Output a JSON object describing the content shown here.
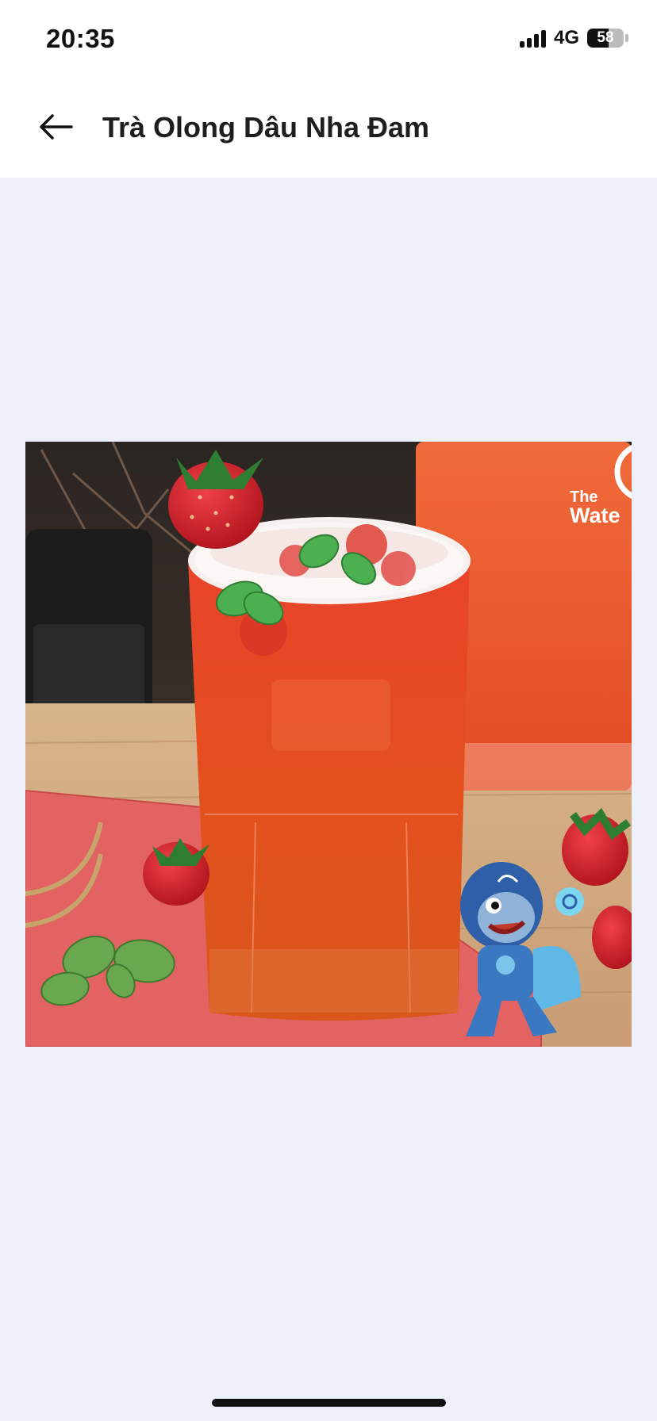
{
  "status_bar": {
    "time": "20:35",
    "network": "4G",
    "battery": "58",
    "battery_level_percent": 58
  },
  "header": {
    "title": "Trà Olong Dâu Nha Đam",
    "back_icon": "arrow-left-icon"
  },
  "product_image": {
    "description_icon": "drink-photo",
    "watermark_line1": "The",
    "watermark_line2": "Wate"
  },
  "colors": {
    "background": "#edf0f8",
    "header_bg": "#ffffff",
    "text": "#1e1e1e"
  }
}
